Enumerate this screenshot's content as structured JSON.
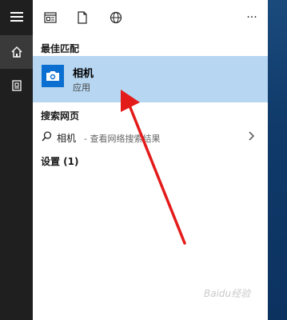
{
  "toolbar": {
    "icons": [
      "document-layout-icon",
      "file-icon",
      "globe-icon",
      "more-icon"
    ],
    "more_label": "···"
  },
  "sections": {
    "best_match": "最佳匹配",
    "web": "搜索网页",
    "settings": "设置 (1)"
  },
  "best_match_item": {
    "name": "相机",
    "type": "应用"
  },
  "web_item": {
    "query": "相机",
    "hint": " - 查看网络搜索结果"
  },
  "watermark": "Baidu经验",
  "colors": {
    "rail": "#1f1f1f",
    "selection": "#b7d6f1",
    "app_tile": "#0a6fd0",
    "arrow": "#e41b1b"
  }
}
